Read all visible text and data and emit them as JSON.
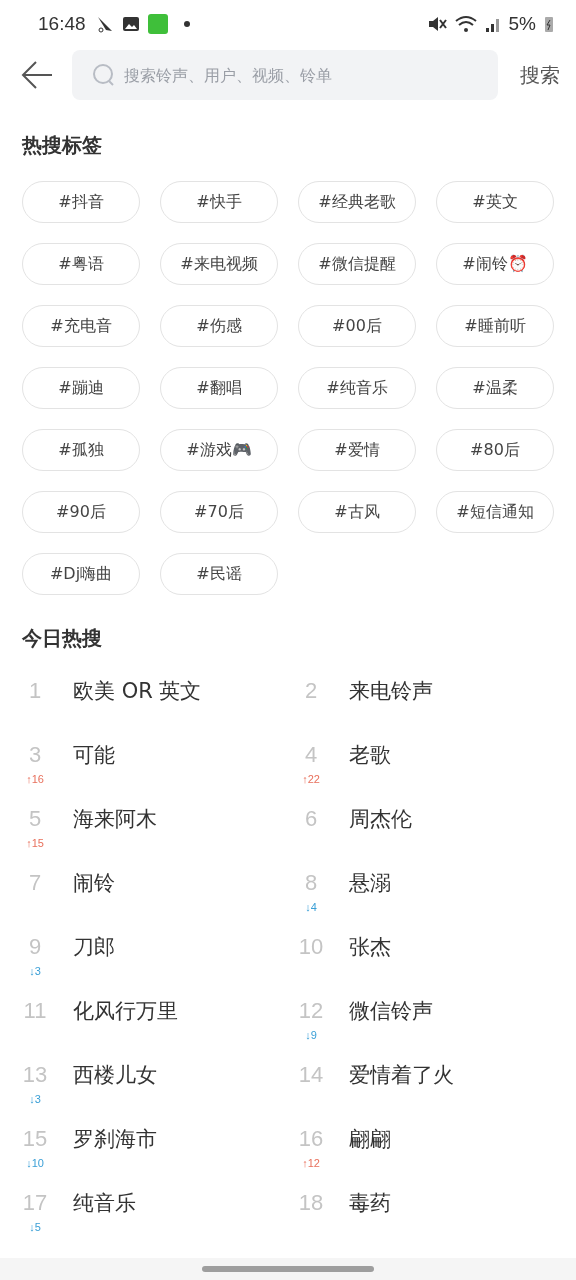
{
  "status_bar": {
    "time": "16:48",
    "battery": "5%"
  },
  "search": {
    "placeholder": "搜索铃声、用户、视频、铃单",
    "button": "搜索"
  },
  "hot_tags": {
    "title": "热搜标签",
    "tags": [
      {
        "label": "#抖音"
      },
      {
        "label": "#快手"
      },
      {
        "label": "#经典老歌"
      },
      {
        "label": "#英文"
      },
      {
        "label": "#粤语"
      },
      {
        "label": "#来电视频"
      },
      {
        "label": "#微信提醒"
      },
      {
        "label": "#闹铃⏰"
      },
      {
        "label": "#充电音"
      },
      {
        "label": "#伤感"
      },
      {
        "label": "#00后"
      },
      {
        "label": "#睡前听"
      },
      {
        "label": "#蹦迪"
      },
      {
        "label": "#翻唱"
      },
      {
        "label": "#纯音乐"
      },
      {
        "label": "#温柔"
      },
      {
        "label": "#孤独"
      },
      {
        "label": "#游戏🎮"
      },
      {
        "label": "#爱情"
      },
      {
        "label": "#80后"
      },
      {
        "label": "#90后"
      },
      {
        "label": "#70后"
      },
      {
        "label": "#古风"
      },
      {
        "label": "#短信通知"
      },
      {
        "label": "#Dj嗨曲"
      },
      {
        "label": "#民谣"
      }
    ]
  },
  "today_hot": {
    "title": "今日热搜",
    "items": [
      {
        "rank": "1",
        "text": "欧美 OR 英文"
      },
      {
        "rank": "2",
        "text": "来电铃声"
      },
      {
        "rank": "3",
        "text": "可能",
        "change": "↑16",
        "kind": "up"
      },
      {
        "rank": "4",
        "text": "老歌",
        "change": "↑22",
        "kind": "up"
      },
      {
        "rank": "5",
        "text": "海来阿木",
        "change": "↑15",
        "kind": "up"
      },
      {
        "rank": "6",
        "text": "周杰伦"
      },
      {
        "rank": "7",
        "text": "闹铃"
      },
      {
        "rank": "8",
        "text": "悬溺",
        "change": "↓4",
        "kind": "down"
      },
      {
        "rank": "9",
        "text": "刀郎",
        "change": "↓3",
        "kind": "down"
      },
      {
        "rank": "10",
        "text": "张杰"
      },
      {
        "rank": "11",
        "text": "化风行万里"
      },
      {
        "rank": "12",
        "text": "微信铃声",
        "change": "↓9",
        "kind": "down"
      },
      {
        "rank": "13",
        "text": "西楼儿女",
        "change": "↓3",
        "kind": "down"
      },
      {
        "rank": "14",
        "text": "爱情着了火"
      },
      {
        "rank": "15",
        "text": "罗刹海市",
        "change": "↓10",
        "kind": "down"
      },
      {
        "rank": "16",
        "text": "翩翩",
        "change": "↑12",
        "kind": "up"
      },
      {
        "rank": "17",
        "text": "纯音乐",
        "change": "↓5",
        "kind": "down"
      },
      {
        "rank": "18",
        "text": "毒药"
      }
    ]
  }
}
